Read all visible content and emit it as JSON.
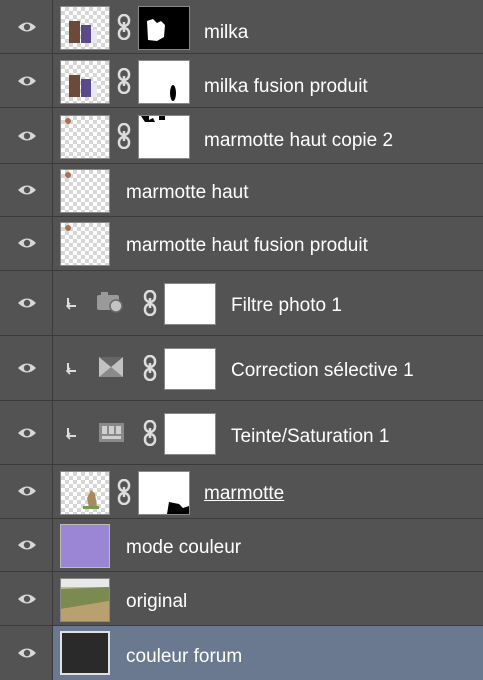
{
  "layers": [
    {
      "name": "milka",
      "icon": "eye-icon"
    },
    {
      "name": "milka fusion produit",
      "icon": "eye-icon"
    },
    {
      "name": "marmotte haut copie 2",
      "icon": "eye-icon"
    },
    {
      "name": "marmotte haut",
      "icon": "eye-icon"
    },
    {
      "name": "marmotte haut fusion produit",
      "icon": "eye-icon"
    },
    {
      "name": "Filtre photo 1",
      "icon": "camera-filter-icon"
    },
    {
      "name": "Correction sélective 1",
      "icon": "selective-color-icon"
    },
    {
      "name": "Teinte/Saturation 1",
      "icon": "hue-saturation-icon"
    },
    {
      "name": "marmotte",
      "icon": "eye-icon"
    },
    {
      "name": "mode couleur",
      "icon": "eye-icon"
    },
    {
      "name": "original",
      "icon": "eye-icon"
    },
    {
      "name": "couleur forum",
      "icon": "eye-icon"
    }
  ],
  "colors": {
    "panel": "#535353",
    "selected_row": "#6a7890",
    "mode_couleur_fill": "#9b86d6",
    "couleur_forum_fill": "#2a2a2a"
  }
}
